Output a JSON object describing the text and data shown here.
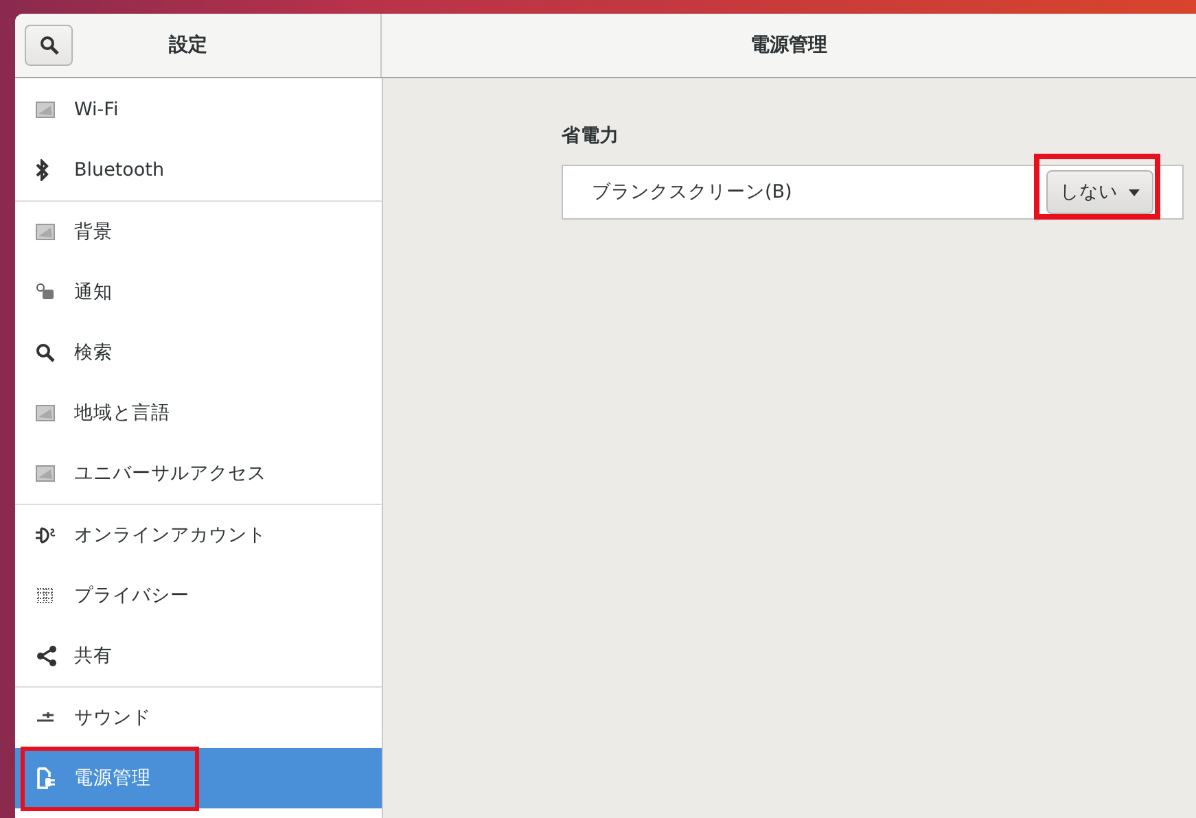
{
  "window": {
    "sidebar_title": "設定",
    "title": "電源管理"
  },
  "sidebar": {
    "groups": [
      [
        {
          "label": "Wi-Fi",
          "selected": false,
          "highlighted": false
        },
        {
          "label": "Bluetooth",
          "selected": false,
          "highlighted": false
        }
      ],
      [
        {
          "label": "背景",
          "selected": false,
          "highlighted": false
        },
        {
          "label": "通知",
          "selected": false,
          "highlighted": false
        },
        {
          "label": "検索",
          "selected": false,
          "highlighted": false
        },
        {
          "label": "地域と言語",
          "selected": false,
          "highlighted": false
        },
        {
          "label": "ユニバーサルアクセス",
          "selected": false,
          "highlighted": false
        }
      ],
      [
        {
          "label": "オンラインアカウント",
          "selected": false,
          "highlighted": false
        },
        {
          "label": "プライバシー",
          "selected": false,
          "highlighted": false
        },
        {
          "label": "共有",
          "selected": false,
          "highlighted": false
        }
      ],
      [
        {
          "label": "サウンド",
          "selected": false,
          "highlighted": false
        },
        {
          "label": "電源管理",
          "selected": true,
          "highlighted": true
        }
      ]
    ]
  },
  "section": {
    "heading": "省電力",
    "rows": [
      {
        "label": "ブランクスクリーン(B)",
        "value": "しない",
        "highlighted": true
      }
    ]
  }
}
